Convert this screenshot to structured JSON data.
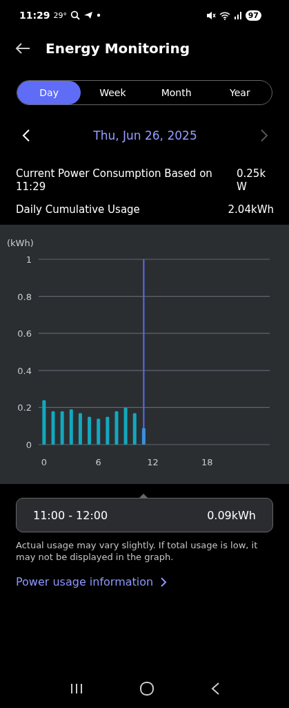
{
  "status_bar": {
    "time": "11:29",
    "temperature": "29°",
    "battery": "97"
  },
  "header": {
    "title": "Energy Monitoring"
  },
  "tabs": [
    {
      "label": "Day",
      "selected": true
    },
    {
      "label": "Week",
      "selected": false
    },
    {
      "label": "Month",
      "selected": false
    },
    {
      "label": "Year",
      "selected": false
    }
  ],
  "date_nav": {
    "date": "Thu, Jun 26, 2025",
    "next_disabled": true
  },
  "stats": [
    {
      "label": "Current Power Consumption Based on 11:29",
      "value": "0.25kW"
    },
    {
      "label": "Daily Cumulative Usage",
      "value": "2.04kWh"
    }
  ],
  "chart": {
    "chart_data": {
      "type": "bar",
      "ylabel": "(kWh)",
      "x": [
        0,
        1,
        2,
        3,
        4,
        5,
        6,
        7,
        8,
        9,
        10,
        11
      ],
      "series": [
        {
          "color": "#13a8be",
          "values": [
            0.24,
            0.18,
            0.18,
            0.19,
            0.17,
            0.15,
            0.14,
            0.15,
            0.18,
            0.2,
            0.17,
            null
          ]
        },
        {
          "color": "#3a8ee0",
          "values": [
            null,
            null,
            null,
            null,
            null,
            null,
            null,
            null,
            null,
            null,
            null,
            0.09
          ]
        }
      ],
      "xlim": [
        -0.6,
        24.9
      ],
      "ylim": [
        0,
        1
      ],
      "yticks": [
        0,
        0.2,
        0.4,
        0.6,
        0.8,
        1
      ],
      "xticks": [
        0,
        6,
        12,
        18
      ],
      "grid": true,
      "ref_lines": [
        {
          "axis": "x",
          "value": 11,
          "color": "#5a6cf0"
        }
      ]
    }
  },
  "tooltip": {
    "range": "11:00 - 12:00",
    "value": "0.09kWh"
  },
  "note": "Actual usage may vary slightly. If total usage is low, it may not be displayed in the graph.",
  "link": "Power usage information"
}
